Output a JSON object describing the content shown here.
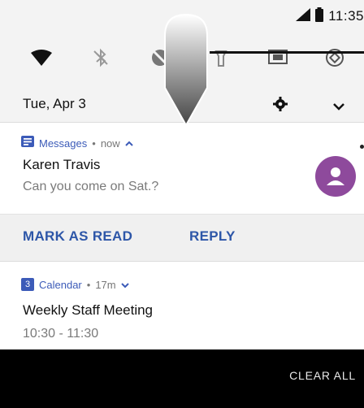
{
  "status": {
    "time": "11:35",
    "icons": [
      "signal-icon",
      "battery-icon"
    ]
  },
  "quick_settings": {
    "icons": [
      "wifi-icon",
      "bluetooth-off-icon",
      "dnd-icon",
      "flashlight-icon",
      "cast-icon",
      "rotate-icon"
    ]
  },
  "header": {
    "date": "Tue, Apr 3",
    "icons": [
      "gear-icon",
      "chevron-down-icon"
    ]
  },
  "notifications": [
    {
      "app": "Messages",
      "separator": "•",
      "time": "now",
      "title": "Karen Travis",
      "body": "Can you come on Sat.?",
      "actions": [
        "MARK AS READ",
        "REPLY"
      ]
    },
    {
      "app": "Calendar",
      "app_badge": "3",
      "separator": "•",
      "time": "17m",
      "title": "Weekly Staff Meeting",
      "body": "10:30 - 11:30"
    }
  ],
  "footer": {
    "clear_all": "CLEAR ALL"
  },
  "colors": {
    "accent": "#2d56a8",
    "avatar": "#8e4a9c",
    "shade_bg": "#f3f3f3"
  }
}
